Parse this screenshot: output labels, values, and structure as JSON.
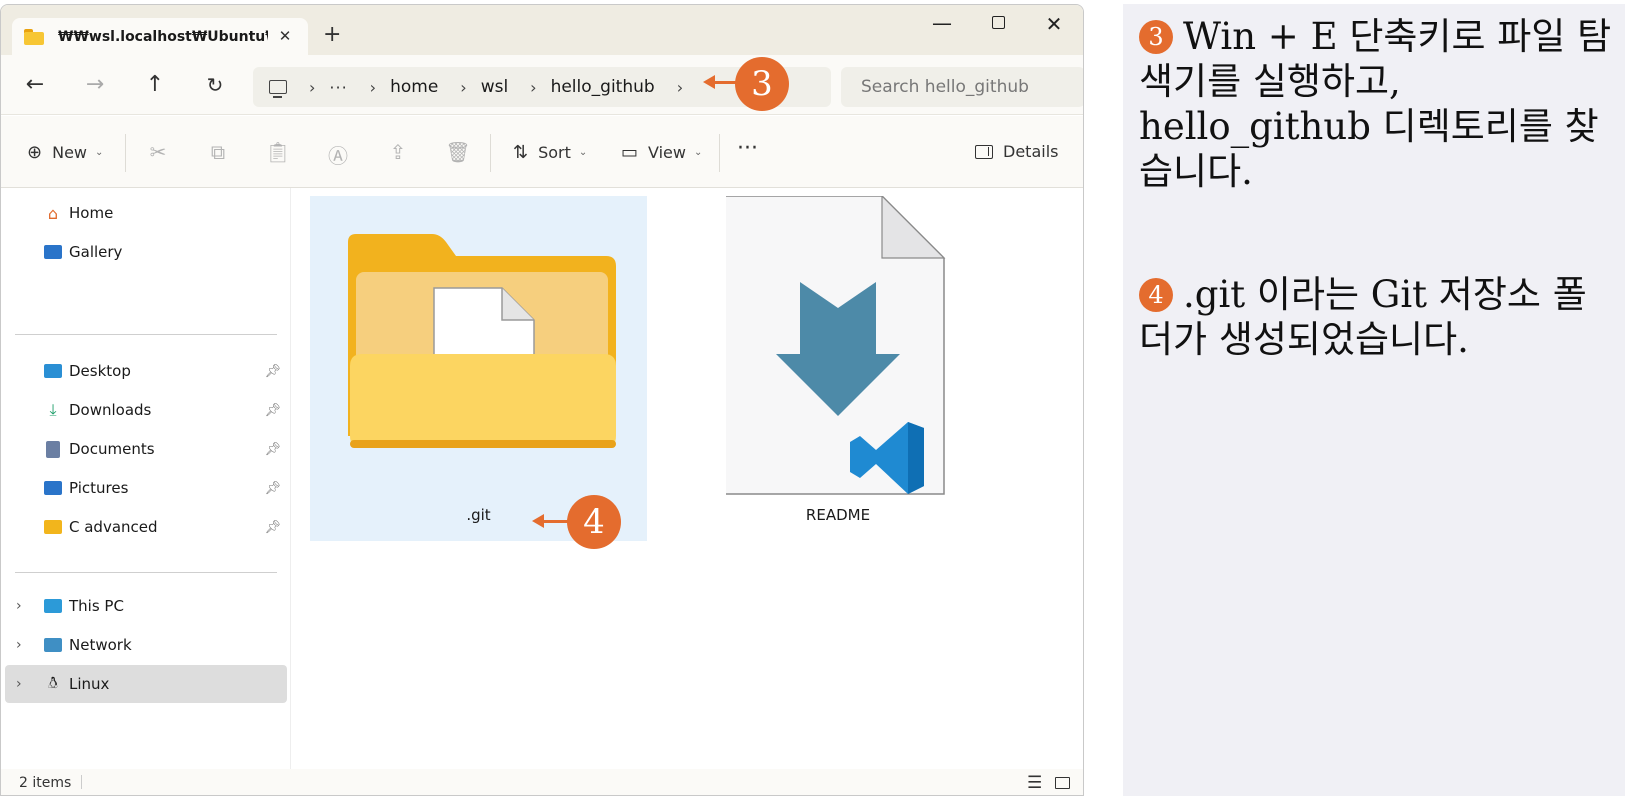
{
  "window": {
    "tab_title": "₩₩wsl.localhost₩Ubuntu₩hc",
    "tab_close": "✕",
    "new_tab": "+",
    "minimize": "—",
    "close": "✕"
  },
  "nav": {
    "back": "←",
    "forward": "→",
    "up": "↑",
    "refresh": "↻"
  },
  "breadcrumb": {
    "more": "···",
    "items": [
      "home",
      "wsl",
      "hello_github"
    ],
    "separator": "›"
  },
  "search": {
    "placeholder": "Search hello_github"
  },
  "toolbar": {
    "new_label": "New",
    "sort_label": "Sort",
    "view_label": "View",
    "more_label": "···",
    "details_label": "Details",
    "icons": [
      "cut-icon",
      "copy-icon",
      "paste-icon",
      "rename-icon",
      "share-icon",
      "delete-icon"
    ]
  },
  "sidebar": {
    "top": [
      {
        "label": "Home",
        "icon": "home-icon"
      },
      {
        "label": "Gallery",
        "icon": "gallery-icon"
      }
    ],
    "pinned": [
      {
        "label": "Desktop",
        "icon": "desktop-icon",
        "color": "#2a8fd4"
      },
      {
        "label": "Downloads",
        "icon": "downloads-icon",
        "color": "#1e9e6a"
      },
      {
        "label": "Documents",
        "icon": "documents-icon",
        "color": "#6b7fa3"
      },
      {
        "label": "Pictures",
        "icon": "pictures-icon",
        "color": "#2a74c9"
      },
      {
        "label": "C advanced",
        "icon": "folder-icon",
        "color": "#f2b51c"
      }
    ],
    "locations": [
      {
        "label": "This PC",
        "icon": "pc-icon"
      },
      {
        "label": "Network",
        "icon": "network-icon"
      },
      {
        "label": "Linux",
        "icon": "linux-icon"
      }
    ]
  },
  "files": [
    {
      "name": ".git",
      "type": "folder",
      "selected": true
    },
    {
      "name": "README",
      "type": "file"
    }
  ],
  "status": {
    "count": "2 items"
  },
  "callouts": {
    "three": "3",
    "four": "4"
  },
  "notes": {
    "step3_num": "3",
    "step3_text": "Win + E 단축키로 파일 탐색기를 실행하고, hello_github 디렉토리를 찾습니다.",
    "step4_num": "4",
    "step4_text": ".git 이라는 Git 저장소 폴더가 생성되었습니다."
  },
  "colors": {
    "accent": "#e46c2e",
    "selection": "#e5f1fb",
    "panel": "#f0f0f5"
  }
}
